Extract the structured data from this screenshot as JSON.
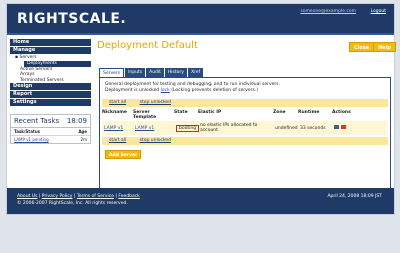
{
  "app": {
    "logo": "RIGHTSCALE.",
    "user": "someone@example.com",
    "logout": "Logout"
  },
  "sidebar": {
    "home": "Home",
    "manage": "Manage",
    "servers": "Servers",
    "deployments": "Deployments",
    "active_servers": "Active Servers",
    "arrays": "Arrays",
    "terminated": "Terminated Servers",
    "design": "Design",
    "report": "Report",
    "settings": "Settings"
  },
  "tasks": {
    "title": "Recent Tasks",
    "time": "18:09",
    "col_task": "Task/Status",
    "col_age": "Age",
    "rows": [
      {
        "task": "LAMP v1 pending",
        "age": "2m"
      }
    ]
  },
  "main": {
    "title": "Deployment Default",
    "close": "Close",
    "help": "Help",
    "tabs": [
      "Servers",
      "Inputs",
      "Audit",
      "History",
      "Xref"
    ],
    "info_line1": "General deployment for testing and debugging, and to run individual servers.",
    "info_line2_prefix": "Deployment is unlocked",
    "lock_link": "lock",
    "info_line2_suffix": "(Locking prevents deletion of servers.)",
    "bar_start": "start all",
    "bar_stop": "stop unlocked",
    "headers": [
      "Nickname",
      "Server Template",
      "State",
      "Elastic IP",
      "Zone",
      "Runtime",
      "Actions"
    ],
    "row": {
      "nickname": "LAMP v1",
      "template": "LAMP v1",
      "state": "booting",
      "elastic": "no elastic IPs allocated to account",
      "zone": "undefined",
      "runtime": "33 seconds"
    },
    "add_server": "Add Server"
  },
  "footer": {
    "about": "About Us",
    "privacy": "Privacy Policy",
    "terms": "Terms of Service",
    "feedback": "Feedback",
    "sep": "|",
    "copyright": "© 2006-2007 RightScale, Inc. All rights reserved.",
    "date": "April 24, 2008 18:09 JST"
  },
  "colors": {
    "navy": "#1f3a66",
    "accent": "#f5b814",
    "title": "#e6a700",
    "highlight": "#e02020"
  }
}
